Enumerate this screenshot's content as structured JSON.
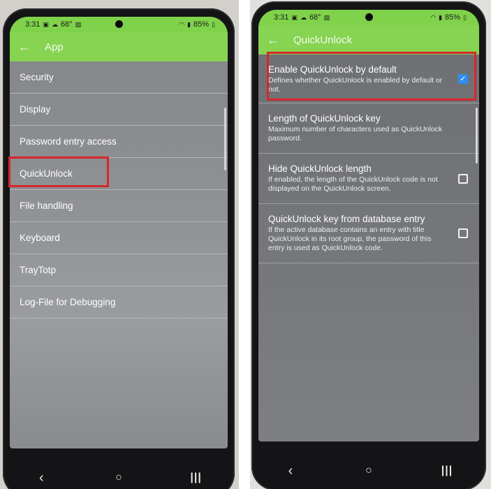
{
  "status_bar": {
    "time": "3:31",
    "temperature": "68°",
    "battery": "85%"
  },
  "left_screen": {
    "title": "App",
    "items": [
      {
        "label": "Security"
      },
      {
        "label": "Display"
      },
      {
        "label": "Password entry access"
      },
      {
        "label": "QuickUnlock",
        "highlighted": true
      },
      {
        "label": "File handling"
      },
      {
        "label": "Keyboard"
      },
      {
        "label": "TrayTotp"
      },
      {
        "label": "Log-File for Debugging"
      }
    ]
  },
  "right_screen": {
    "title": "QuickUnlock",
    "items": [
      {
        "title": "Enable QuickUnlock by default",
        "summary": "Defines whether QuickUnlock is enabled by default or not.",
        "checkbox": true,
        "checked": true,
        "highlighted": true
      },
      {
        "title": "Length of QuickUnlock key",
        "summary": "Maximum number of characters used as QuickUnlock password.",
        "checkbox": false
      },
      {
        "title": "Hide QuickUnlock length",
        "summary": "If enabled, the length of the QuickUnlock code is not displayed on the QuickUnlock screen.",
        "checkbox": true,
        "checked": false
      },
      {
        "title": "QuickUnlock key from database entry",
        "summary": "If the active database contains an entry with title QuickUnlock in its root group, the password of this entry is used as QuickUnlock code.",
        "checkbox": true,
        "checked": false
      }
    ]
  },
  "icons": {
    "back": "back-arrow-icon",
    "nav_back": "nav-back-icon",
    "nav_home": "nav-home-icon",
    "nav_recents": "nav-recents-icon"
  },
  "colors": {
    "toolbar": "#86d452",
    "highlight": "#d8262c",
    "checkbox_checked": "#2f8df0"
  }
}
